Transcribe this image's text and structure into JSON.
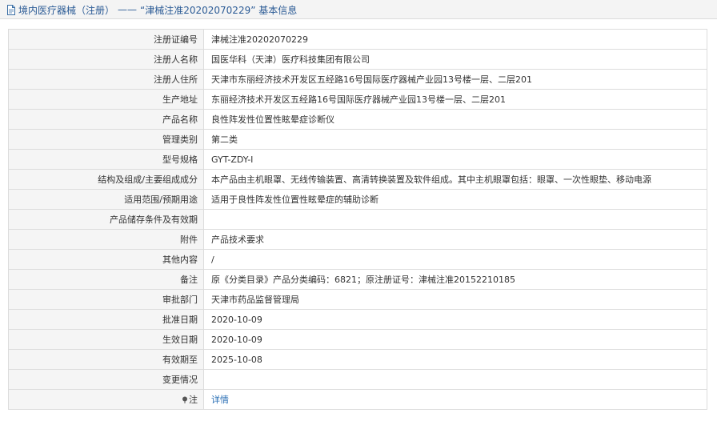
{
  "header": {
    "section": "境内医疗器械（注册）",
    "dash": "——",
    "reg_title": "“津械注准20202070229” 基本信息"
  },
  "rows": [
    {
      "label": "注册证编号",
      "value": "津械注准20202070229"
    },
    {
      "label": "注册人名称",
      "value": "国医华科（天津）医疗科技集团有限公司"
    },
    {
      "label": "注册人住所",
      "value": "天津市东丽经济技术开发区五经路16号国际医疗器械产业园13号楼一层、二层201"
    },
    {
      "label": "生产地址",
      "value": "东丽经济技术开发区五经路16号国际医疗器械产业园13号楼一层、二层201"
    },
    {
      "label": "产品名称",
      "value": "良性阵发性位置性眩晕症诊断仪"
    },
    {
      "label": "管理类别",
      "value": "第二类"
    },
    {
      "label": "型号规格",
      "value": "GYT-ZDY-I"
    },
    {
      "label": "结构及组成/主要组成成分",
      "value": "本产品由主机眼罩、无线传输装置、高清转换装置及软件组成。其中主机眼罩包括：眼罩、一次性眼垫、移动电源"
    },
    {
      "label": "适用范围/预期用途",
      "value": "适用于良性阵发性位置性眩晕症的辅助诊断"
    },
    {
      "label": "产品储存条件及有效期",
      "value": ""
    },
    {
      "label": "附件",
      "value": "产品技术要求"
    },
    {
      "label": "其他内容",
      "value": "/"
    },
    {
      "label": "备注",
      "value": "原《分类目录》产品分类编码：6821；原注册证号：津械注准20152210185"
    },
    {
      "label": "审批部门",
      "value": "天津市药品监督管理局"
    },
    {
      "label": "批准日期",
      "value": "2020-10-09"
    },
    {
      "label": "生效日期",
      "value": "2020-10-09"
    },
    {
      "label": "有效期至",
      "value": "2025-10-08"
    },
    {
      "label": "变更情况",
      "value": ""
    }
  ],
  "note_row": {
    "label": "注",
    "link": "详情"
  }
}
